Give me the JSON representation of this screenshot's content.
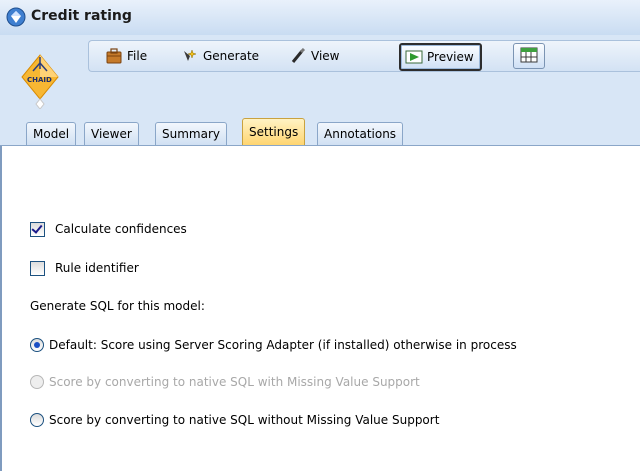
{
  "window": {
    "title": "Credit rating"
  },
  "node": {
    "icon": "chaid-node-icon",
    "label": "CHAID"
  },
  "toolbar": {
    "file_label": "File",
    "generate_label": "Generate",
    "view_label": "View",
    "preview_label": "Preview",
    "export_icon": "export-table-icon"
  },
  "tabs": [
    {
      "label": "Model"
    },
    {
      "label": "Viewer"
    },
    {
      "label": "Summary"
    },
    {
      "label": "Settings",
      "active": true
    },
    {
      "label": "Annotations"
    }
  ],
  "settings": {
    "calculate_confidences": {
      "label": "Calculate confidences",
      "checked": true
    },
    "rule_identifier": {
      "label": "Rule identifier",
      "checked": false
    },
    "sql_heading": "Generate SQL for this model:",
    "sql_options": [
      {
        "label": "Default:  Score using Server Scoring Adapter (if installed) otherwise in process",
        "selected": true,
        "enabled": true
      },
      {
        "label": "Score by converting to native SQL with Missing Value Support",
        "selected": false,
        "enabled": false
      },
      {
        "label": "Score by converting to native SQL without Missing Value Support",
        "selected": false,
        "enabled": true
      }
    ]
  },
  "colors": {
    "accent_tab": "#ffd36b",
    "chrome": "#d8e6f6"
  }
}
